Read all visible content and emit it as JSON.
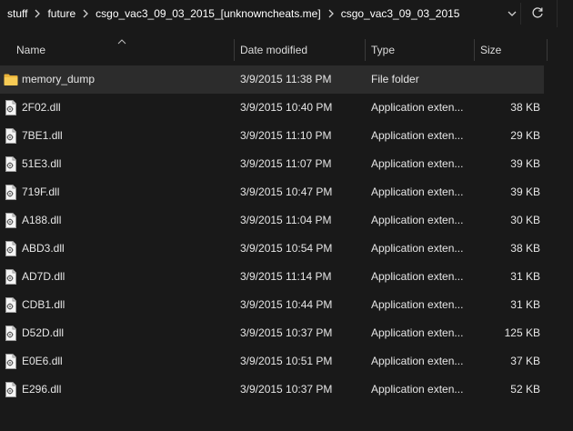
{
  "breadcrumb": {
    "items": [
      "stuff",
      "future",
      "csgo_vac3_09_03_2015_[unknowncheats.me]",
      "csgo_vac3_09_03_2015"
    ]
  },
  "columns": {
    "name": "Name",
    "date": "Date modified",
    "type": "Type",
    "size": "Size"
  },
  "files": [
    {
      "name": "memory_dump",
      "date": "3/9/2015 11:38 PM",
      "type": "File folder",
      "size": "",
      "icon": "folder-icon"
    },
    {
      "name": "2F02.dll",
      "date": "3/9/2015 10:40 PM",
      "type": "Application exten...",
      "size": "38 KB",
      "icon": "dll-file-icon"
    },
    {
      "name": "7BE1.dll",
      "date": "3/9/2015 11:10 PM",
      "type": "Application exten...",
      "size": "29 KB",
      "icon": "dll-file-icon"
    },
    {
      "name": "51E3.dll",
      "date": "3/9/2015 11:07 PM",
      "type": "Application exten...",
      "size": "39 KB",
      "icon": "dll-file-icon"
    },
    {
      "name": "719F.dll",
      "date": "3/9/2015 10:47 PM",
      "type": "Application exten...",
      "size": "39 KB",
      "icon": "dll-file-icon"
    },
    {
      "name": "A188.dll",
      "date": "3/9/2015 11:04 PM",
      "type": "Application exten...",
      "size": "30 KB",
      "icon": "dll-file-icon"
    },
    {
      "name": "ABD3.dll",
      "date": "3/9/2015 10:54 PM",
      "type": "Application exten...",
      "size": "38 KB",
      "icon": "dll-file-icon"
    },
    {
      "name": "AD7D.dll",
      "date": "3/9/2015 11:14 PM",
      "type": "Application exten...",
      "size": "31 KB",
      "icon": "dll-file-icon"
    },
    {
      "name": "CDB1.dll",
      "date": "3/9/2015 10:44 PM",
      "type": "Application exten...",
      "size": "31 KB",
      "icon": "dll-file-icon"
    },
    {
      "name": "D52D.dll",
      "date": "3/9/2015 10:37 PM",
      "type": "Application exten...",
      "size": "125 KB",
      "icon": "dll-file-icon"
    },
    {
      "name": "E0E6.dll",
      "date": "3/9/2015 10:51 PM",
      "type": "Application exten...",
      "size": "37 KB",
      "icon": "dll-file-icon"
    },
    {
      "name": "E296.dll",
      "date": "3/9/2015 10:37 PM",
      "type": "Application exten...",
      "size": "52 KB",
      "icon": "dll-file-icon"
    }
  ],
  "selected_index": 0,
  "colors": {
    "background": "#191919",
    "selection": "#2c2c2c",
    "folder": "#f4c542",
    "text": "#e6e6e6"
  }
}
